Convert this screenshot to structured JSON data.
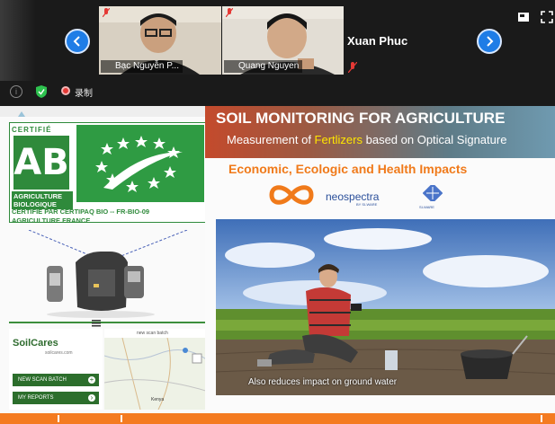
{
  "meeting": {
    "participants": [
      {
        "name": "Bạc Nguyễn P..."
      },
      {
        "name": "Quang Nguyen"
      }
    ],
    "active_speaker_name": "Xuan Phuc",
    "recording_label": "录制"
  },
  "slide": {
    "certification": {
      "certifie_label": "CERTIFIÉ",
      "ab_letters": "AB",
      "agriculture_bio": "AGRICULTURE BIOLOGIQUE",
      "cert_line1": "CERTIFIE PAR CERTIPAQ BIO -- FR-BIO-09",
      "cert_line2": "AGRICULTURE FRANCE"
    },
    "soilcares": {
      "logo": "SoilCares",
      "sub": "soilcares.com",
      "map_header": "new scan batch",
      "new_scan_batch": "NEW SCAN BATCH",
      "my_reports": "MY REPORTS",
      "map_label": "Kenya"
    },
    "banner": {
      "title": "SOIL MONITORING FOR AGRICULTURE",
      "subtitle_prefix": "Measurement of ",
      "subtitle_highlight": "Fertlizers",
      "subtitle_suffix": " based on Optical Signature"
    },
    "impacts_title": "Economic, Ecologic and Health Impacts",
    "logos": {
      "neospectra": "neospectra",
      "neospectra_sub": "BY SI-WARE",
      "siware": "SI-WARE"
    },
    "photo_caption": "Also reduces impact on ground water"
  },
  "colors": {
    "nav_button": "#1f7de6",
    "banner_orange": "#c44a2c",
    "impacts_orange": "#f07a1a",
    "bio_green": "#2f8a3b",
    "highlight_yellow": "#ffe600",
    "bottom_strip": "#f47b20"
  },
  "icons": [
    "chevron-left-icon",
    "chevron-right-icon",
    "mic-off-icon",
    "layout-icon",
    "fullscreen-icon",
    "info-icon",
    "shield-icon",
    "record-icon",
    "menu-icon"
  ]
}
